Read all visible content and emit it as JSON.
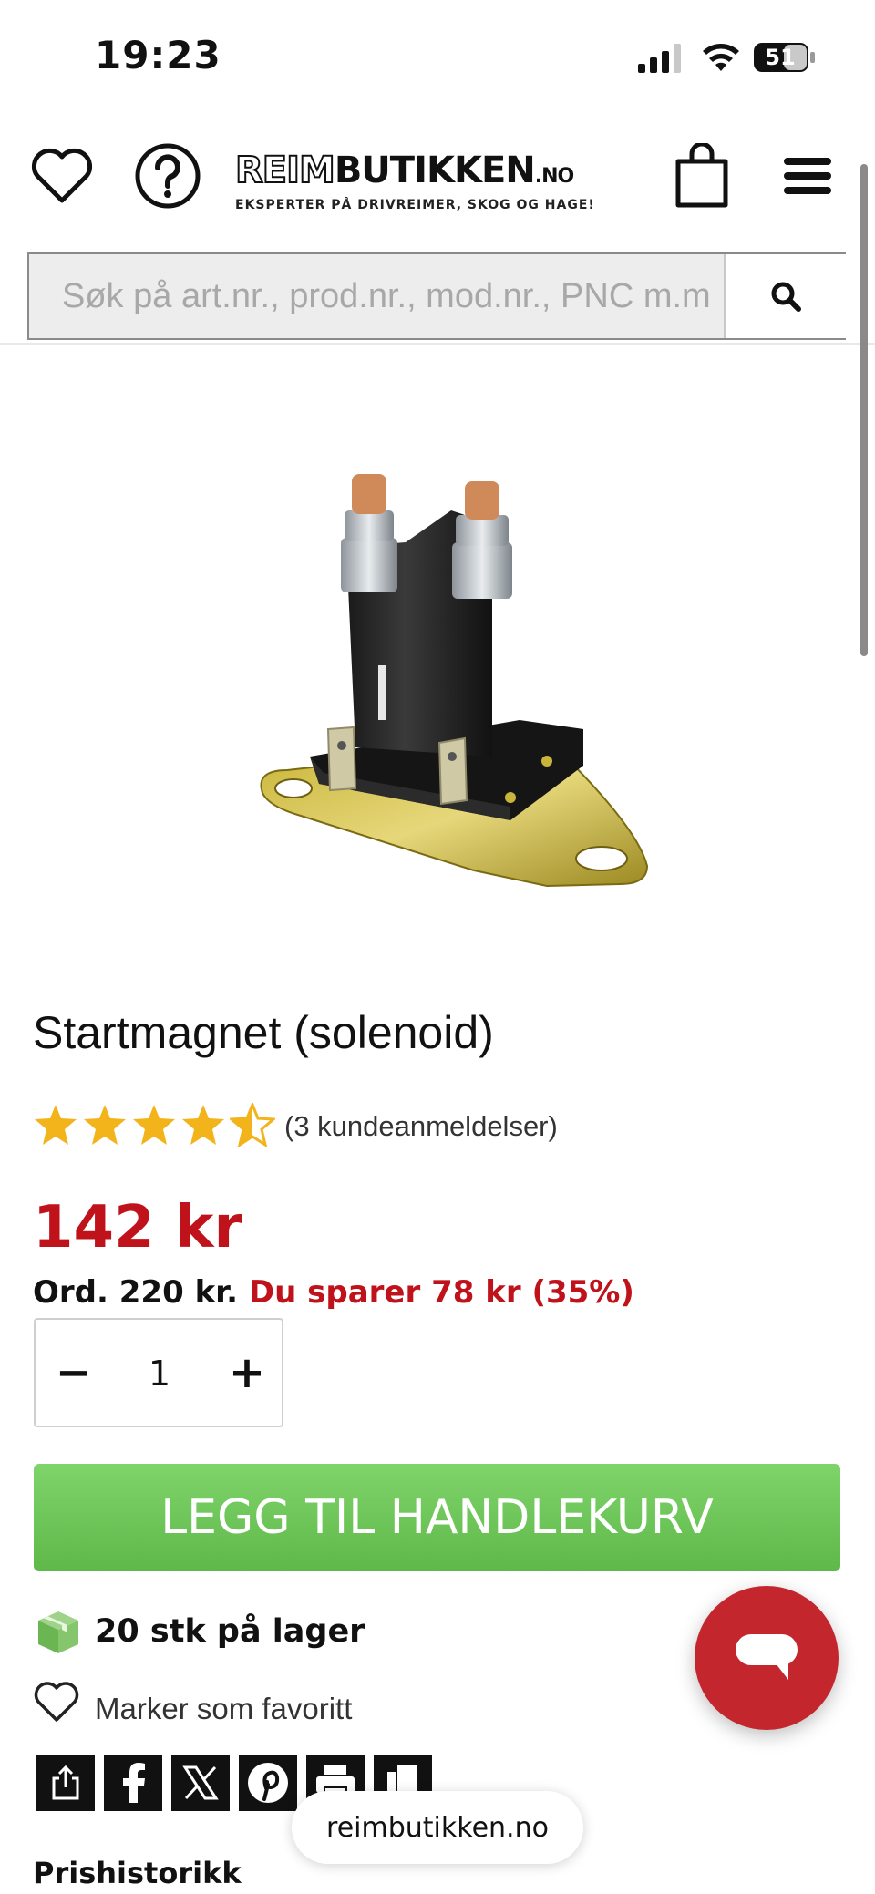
{
  "status_bar": {
    "time": "19:23",
    "battery": "51"
  },
  "header": {
    "icons": [
      "heart-icon",
      "help-icon",
      "shopping-bag-icon",
      "menu-icon"
    ],
    "logo": {
      "text_outline": "REIM",
      "text_bold": "BUTIKKEN",
      "text_domain": ".NO",
      "tagline": "EKSPERTER PÅ DRIVREIMER, SKOG OG HAGE!"
    }
  },
  "search": {
    "placeholder": "Søk på art.nr., prod.nr., mod.nr., PNC m.m",
    "button_icon": "search-icon"
  },
  "product": {
    "title": "Startmagnet (solenoid)",
    "rating": 4.5,
    "rating_max": 5,
    "reviews_text": "(3 kundeanmeldelser)",
    "price": "142 kr",
    "ordinary_price": "Ord. 220 kr.",
    "savings": "Du sparer 78 kr (35%)",
    "quantity": "1",
    "qty_minus": "−",
    "qty_plus": "+",
    "add_to_cart": "LEGG TIL HANDLEKURV",
    "stock": "20 stk på lager",
    "favorite": "Marker som favoritt"
  },
  "share_icons": [
    "share-icon",
    "facebook-icon",
    "x-icon",
    "pinterest-icon",
    "print-icon",
    "copy-icon"
  ],
  "browser": {
    "url": "reimbutikken.no"
  },
  "section": {
    "price_history": "Prishistorikk"
  },
  "colors": {
    "accent_red": "#c0121a",
    "cart_green": "#6cc456",
    "chat_red": "#c4262e"
  }
}
